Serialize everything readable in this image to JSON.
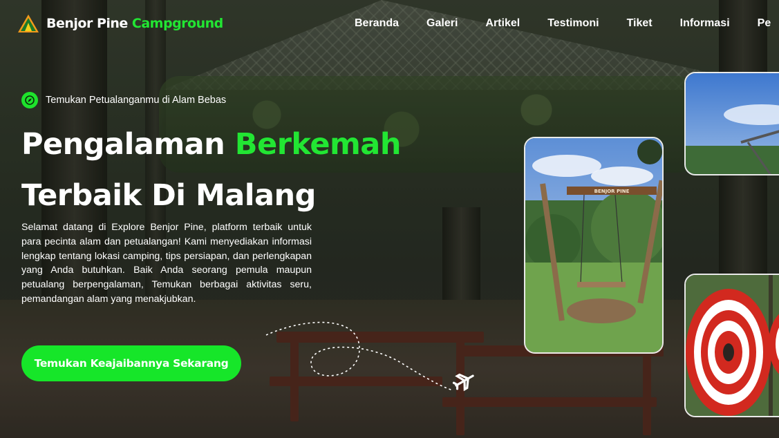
{
  "brand": {
    "name_part1": "Benjor Pine",
    "name_part2": "Campground",
    "logo_icon": "tent-icon",
    "accent_color": "#22e633"
  },
  "nav": {
    "items": [
      "Beranda",
      "Galeri",
      "Artikel",
      "Testimoni",
      "Tiket",
      "Informasi",
      "Pe"
    ]
  },
  "hero": {
    "badge_icon": "compass-icon",
    "badge_text": "Temukan Petualanganmu di Alam Bebas",
    "headline_part1": "Pengalaman ",
    "headline_accent": "Berkemah",
    "headline_part2": "Terbaik Di Malang",
    "description": "Selamat datang di Explore Benjor Pine, platform terbaik untuk para pecinta alam dan petualangan! Kami menyediakan informasi lengkap tentang lokasi camping, tips persiapan, dan perlengkapan yang Anda butuhkan. Baik Anda seorang pemula maupun petualang berpengalaman, Temukan berbagai aktivitas seru, pemandangan alam yang menakjubkan.",
    "cta_label": "Temukan Keajaibannya Sekarang",
    "cta_color": "#16e629",
    "decor_icon": "airplane-icon"
  },
  "photos": {
    "swing_sign_text": "BENJOR PINE"
  }
}
